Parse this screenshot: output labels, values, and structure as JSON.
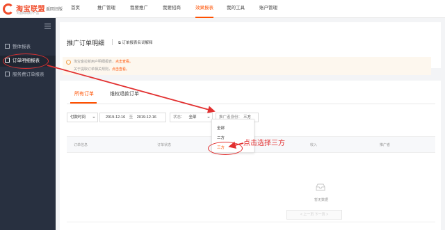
{
  "header": {
    "logo_text": "淘宝联盟",
    "logo_sub": "阿里妈妈旗下产品",
    "back_home": "返回旧版",
    "nav": [
      "首页",
      "推广管理",
      "我要推广",
      "我要招商",
      "效果报表",
      "我的工具",
      "账户管理"
    ],
    "active_nav": "效果报表"
  },
  "sidebar": {
    "items": [
      {
        "label": "整体报表"
      },
      {
        "label": "订单明细报表"
      },
      {
        "label": "服务费订单报表"
      }
    ],
    "active": "订单明细报表"
  },
  "page": {
    "title": "推广订单明细",
    "explain_link": "订单报表名词解释",
    "notice": [
      {
        "text": "淘宝客拉新用户明细报表，",
        "link": "点击查看。"
      },
      {
        "text": "关于提取订单相关规则，",
        "link": "点击查看。"
      }
    ],
    "tabs": [
      "所有订单",
      "维权退款订单"
    ],
    "active_tab": "所有订单"
  },
  "filters": {
    "time_label": "付款时间",
    "date_from": "2019-12-16",
    "date_sep": "至",
    "date_to": "2019-12-16",
    "status_label": "状态：",
    "status_value": "全部",
    "role_label": "推广者身份：",
    "role_value": "三方"
  },
  "dropdown": {
    "options": [
      "全部",
      "二方",
      "三方"
    ],
    "selected": "三方"
  },
  "table": {
    "headers": [
      "订单信息",
      "订单状态",
      "收入",
      "推广者"
    ],
    "empty_text": "暂无数据"
  },
  "pager": {
    "text": "< 上一页  下一页 >"
  },
  "annotation": {
    "label": "点击选择三方",
    "color": "#e23030"
  },
  "colors": {
    "accent": "#ff5000",
    "sidebar_bg": "#283040"
  }
}
